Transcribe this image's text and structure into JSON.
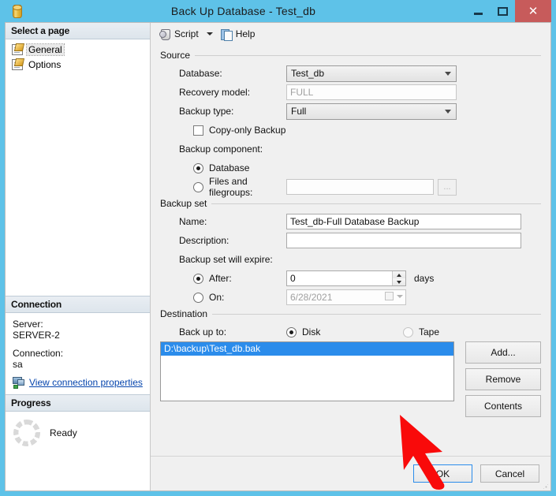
{
  "window": {
    "title": "Back Up Database - Test_db",
    "icon": "database-cylinder-icon",
    "minimize_label": "Minimize",
    "maximize_label": "Maximize",
    "close_label": "✕"
  },
  "toolbar": {
    "script_label": "Script",
    "help_label": "Help"
  },
  "sidebar": {
    "select_page_header": "Select a page",
    "items": [
      {
        "label": "General",
        "selected": true
      },
      {
        "label": "Options",
        "selected": false
      }
    ],
    "connection": {
      "header": "Connection",
      "server_label": "Server:",
      "server_value": "SERVER-2",
      "connection_label": "Connection:",
      "connection_value": "sa",
      "view_properties_link": "View connection properties"
    },
    "progress": {
      "header": "Progress",
      "status": "Ready"
    }
  },
  "source": {
    "group_title": "Source",
    "database_label": "Database:",
    "database_value": "Test_db",
    "recovery_model_label": "Recovery model:",
    "recovery_model_value": "FULL",
    "backup_type_label": "Backup type:",
    "backup_type_value": "Full",
    "copy_only_label": "Copy-only Backup",
    "copy_only_checked": false,
    "backup_component_label": "Backup component:",
    "component_database_label": "Database",
    "component_database_selected": true,
    "component_files_label": "Files and filegroups:",
    "component_files_selected": false,
    "files_value": "",
    "browse_label": "..."
  },
  "backup_set": {
    "group_title": "Backup set",
    "name_label": "Name:",
    "name_value": "Test_db-Full Database Backup",
    "description_label": "Description:",
    "description_value": "",
    "expire_label": "Backup set will expire:",
    "after_label": "After:",
    "after_selected": true,
    "after_value": "0",
    "days_label": "days",
    "on_label": "On:",
    "on_selected": false,
    "on_value": "6/28/2021"
  },
  "destination": {
    "group_title": "Destination",
    "back_up_to_label": "Back up to:",
    "disk_label": "Disk",
    "disk_selected": true,
    "tape_label": "Tape",
    "tape_enabled": false,
    "paths": [
      "D:\\backup\\Test_db.bak"
    ],
    "add_label": "Add...",
    "remove_label": "Remove",
    "contents_label": "Contents"
  },
  "footer": {
    "ok_label": "OK",
    "cancel_label": "Cancel"
  },
  "annotations": {
    "highlight_color": "#f01010",
    "oval_target": "add-remove-buttons",
    "arrow_target": "destination-path-item"
  }
}
